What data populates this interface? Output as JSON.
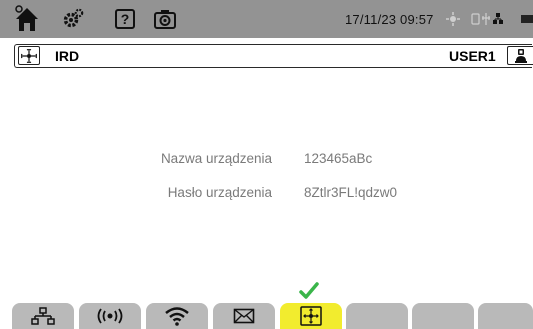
{
  "status_bar": {
    "datetime": "17/11/23 09:57",
    "icons": [
      "home-icon",
      "settings-icon",
      "help-icon",
      "camera-icon",
      "sun-icon",
      "ports-icon",
      "battery-icon"
    ]
  },
  "header": {
    "title": "IRD",
    "user": "USER1",
    "icons": [
      "ird-icon",
      "user-lock-icon"
    ]
  },
  "form": {
    "fields": [
      {
        "label": "Nazwa urządzenia",
        "value": "123465aBc"
      },
      {
        "label": "Hasło urządzenia",
        "value": "8Ztlr3FL!qdzw0"
      }
    ]
  },
  "tabs": [
    {
      "icon": "network-icon",
      "active": false
    },
    {
      "icon": "broadcast-icon",
      "active": false
    },
    {
      "icon": "wifi-icon",
      "active": false
    },
    {
      "icon": "mail-icon",
      "active": false
    },
    {
      "icon": "ird-icon",
      "active": true
    },
    {
      "icon": "",
      "active": false
    },
    {
      "icon": "",
      "active": false
    },
    {
      "icon": "",
      "active": false
    }
  ],
  "colors": {
    "status_bar_bg": "#939393",
    "tab_bg": "#b9b9b9",
    "tab_active_bg": "#f2ec2e",
    "check_color": "#3ab54a",
    "label_text": "#7a7a7a"
  }
}
